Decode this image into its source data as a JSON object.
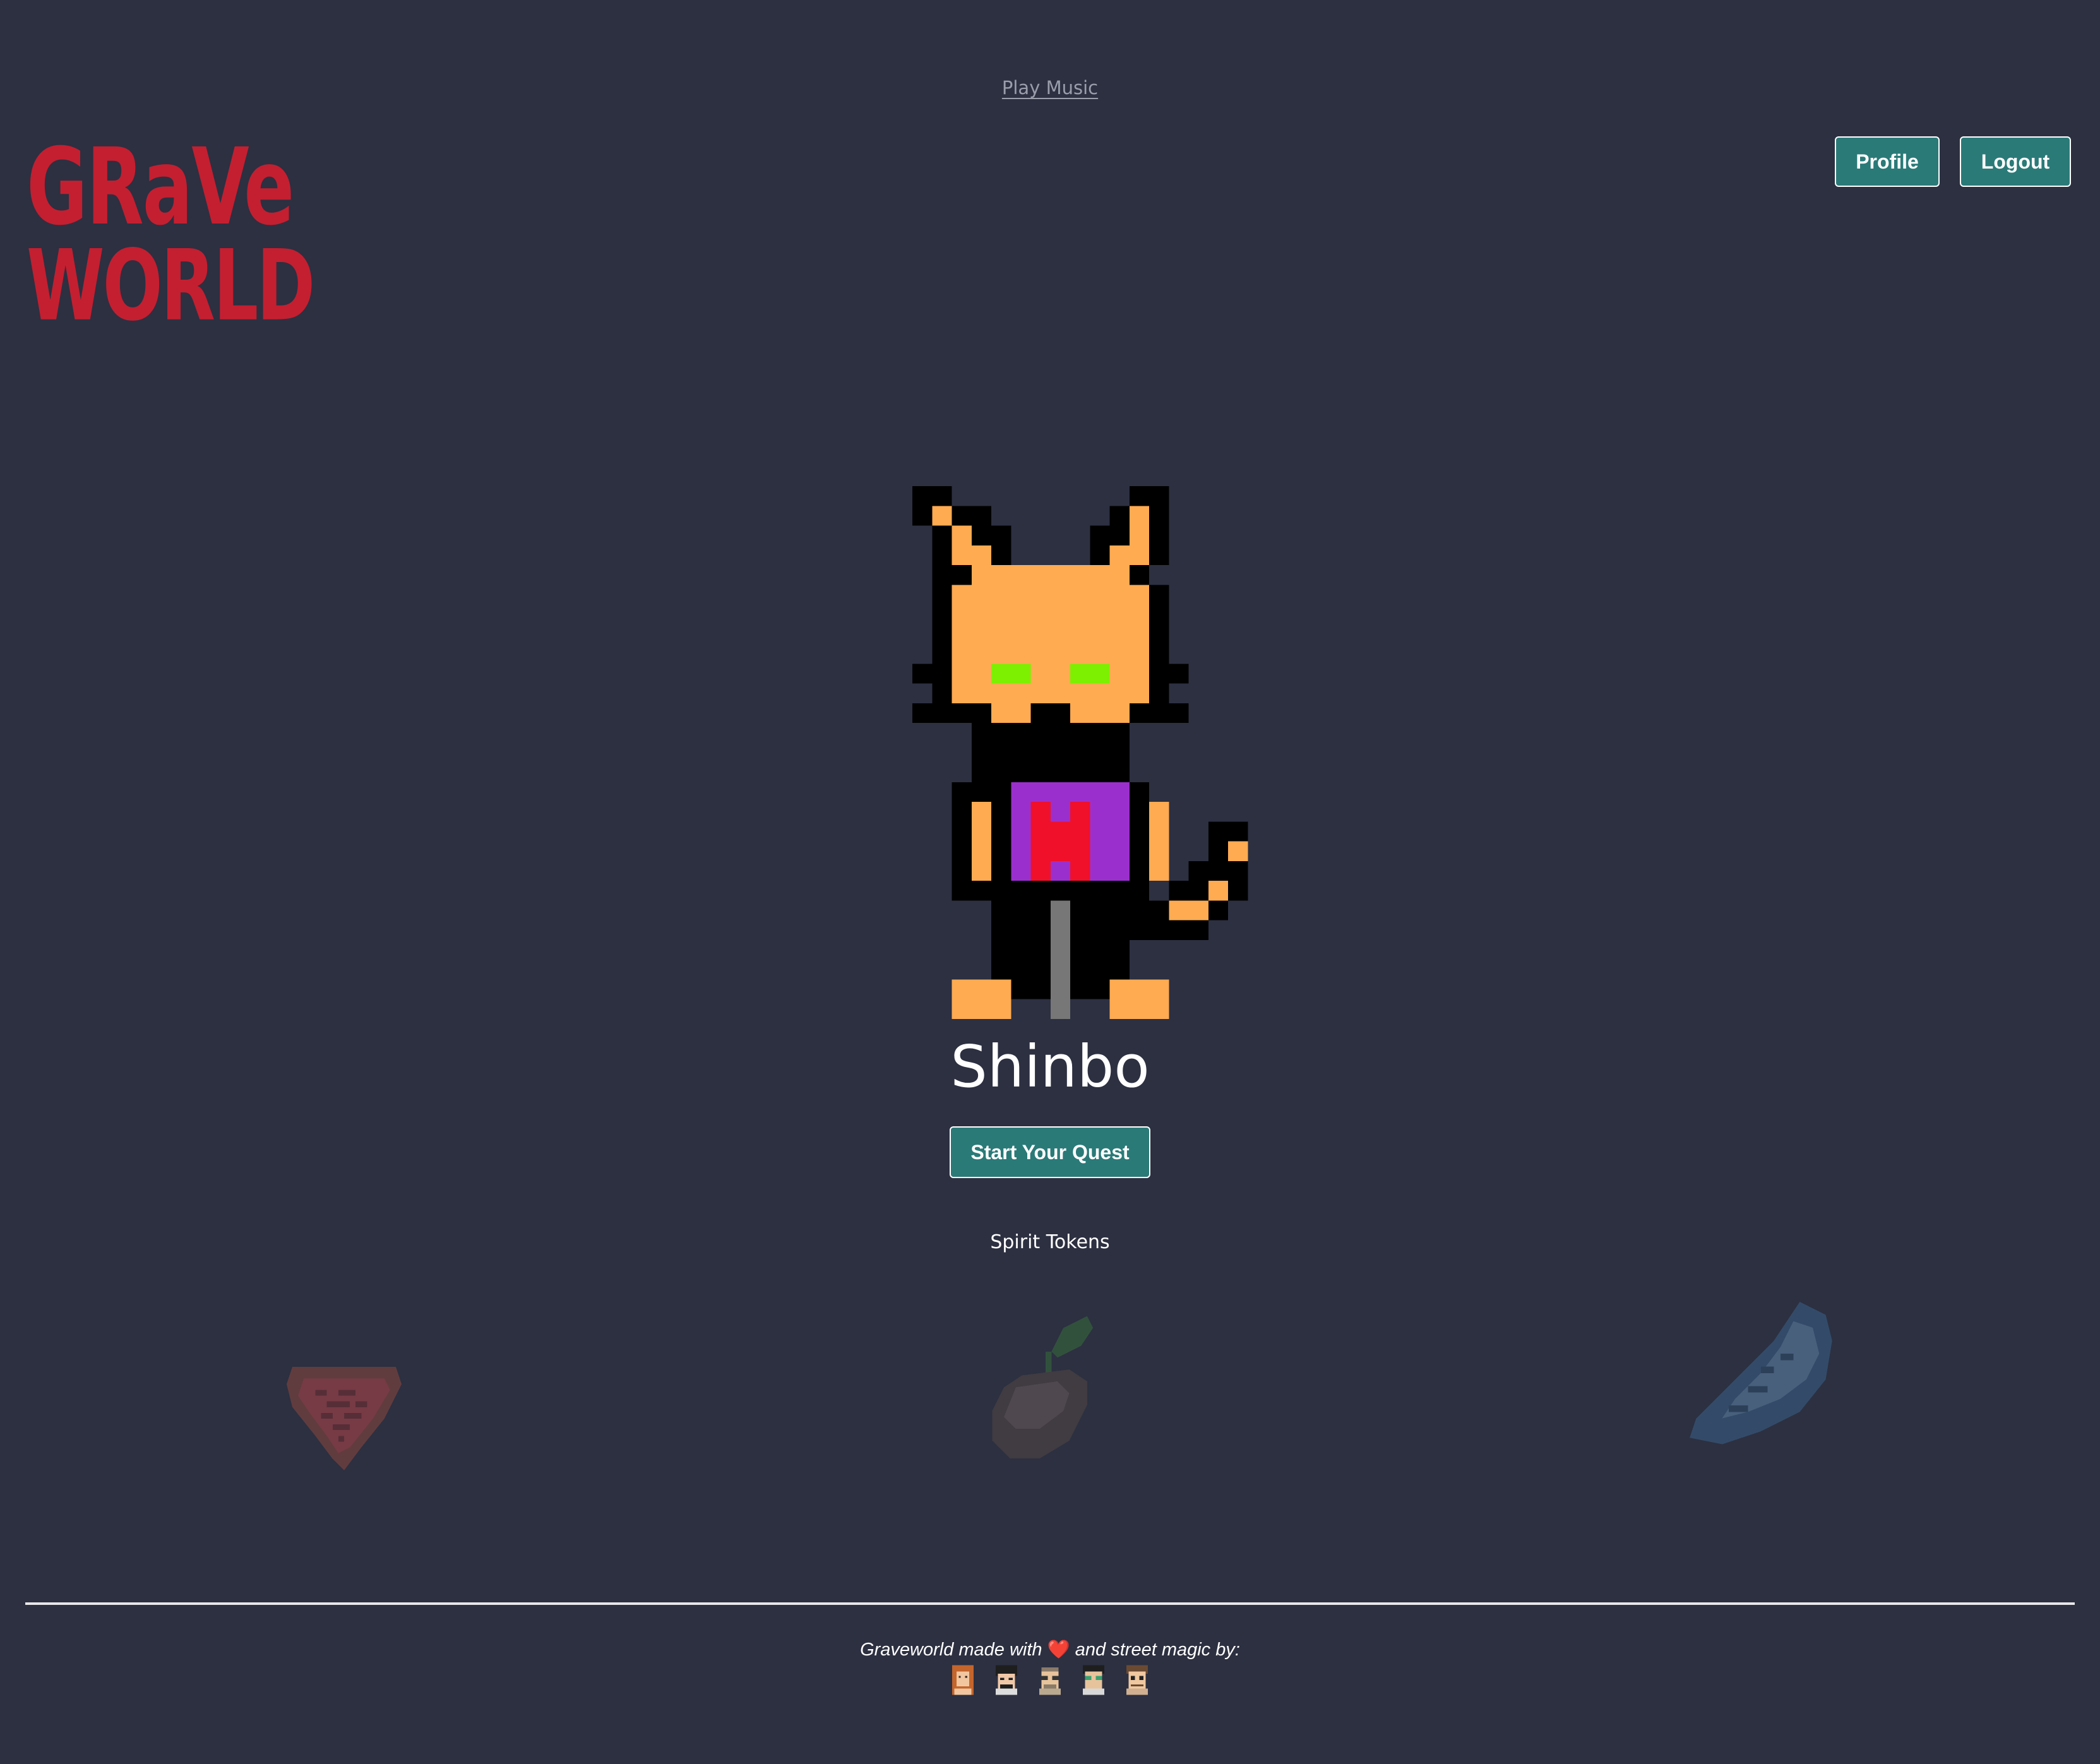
{
  "header": {
    "music_link": "Play Music",
    "logo_line1": "GRaVe",
    "logo_line2": "WORLD"
  },
  "nav": {
    "profile_label": "Profile",
    "logout_label": "Logout"
  },
  "character": {
    "name": "Shinbo",
    "avatar_icon": "pixel-cat-icon",
    "quest_button_label": "Start Your Quest"
  },
  "spirit_tokens": {
    "label": "Spirit Tokens",
    "items": [
      {
        "icon": "heart-gem-icon",
        "state": "locked"
      },
      {
        "icon": "seed-sprout-icon",
        "state": "locked"
      },
      {
        "icon": "feather-icon",
        "state": "locked"
      }
    ]
  },
  "footer": {
    "credits_before": "Graveworld made with",
    "credits_heart": "❤️",
    "credits_after": "and street magic by:",
    "makers": [
      {
        "icon": "maker-avatar-1-icon"
      },
      {
        "icon": "maker-avatar-2-icon"
      },
      {
        "icon": "maker-avatar-3-icon"
      },
      {
        "icon": "maker-avatar-4-icon"
      },
      {
        "icon": "maker-avatar-5-icon"
      }
    ]
  },
  "colors": {
    "background": "#2c3041",
    "logo": "#c41f30",
    "button": "#2a7a78",
    "cat_fur": "#ffab52",
    "cat_eyes": "#7cf000",
    "shirt": "#9b2fce",
    "shirt_emblem": "#f0102a"
  }
}
